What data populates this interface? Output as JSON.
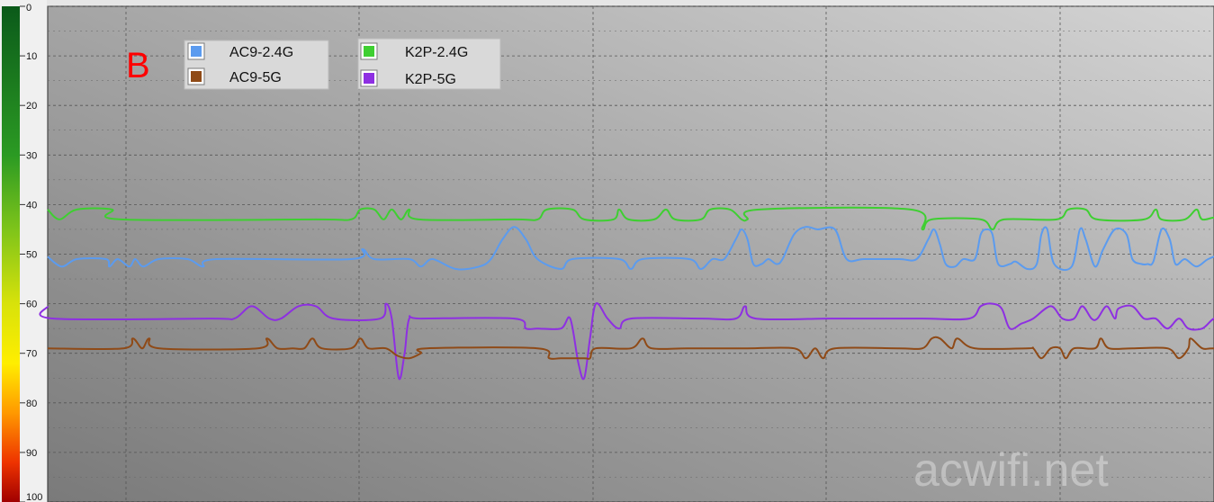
{
  "chart_data": {
    "type": "line",
    "panel_letter": "B",
    "watermark": "acwifi.net",
    "y_scale": "color_bar",
    "ylim": [
      0,
      100
    ],
    "y_inverted": true,
    "y_ticks": [
      0,
      10,
      20,
      30,
      40,
      50,
      60,
      70,
      80,
      90,
      100
    ],
    "x_range": [
      0,
      100
    ],
    "grid": true,
    "legend_placement": "top-left",
    "series": [
      {
        "name": "AC9-2.4G",
        "color": "#5b9bef",
        "points": [
          [
            0,
            50.5
          ],
          [
            1.2,
            52.5
          ],
          [
            2.5,
            51
          ],
          [
            5,
            51
          ],
          [
            5.3,
            52.5
          ],
          [
            6,
            51
          ],
          [
            7,
            52.5
          ],
          [
            7.5,
            51
          ],
          [
            8.2,
            52.5
          ],
          [
            9.5,
            51
          ],
          [
            12,
            51
          ],
          [
            13.3,
            52.5
          ],
          [
            14.5,
            51
          ],
          [
            26,
            51
          ],
          [
            27,
            49
          ],
          [
            28,
            51
          ],
          [
            31,
            51
          ],
          [
            32,
            52.5
          ],
          [
            33,
            51
          ],
          [
            35,
            53
          ],
          [
            37,
            52.5
          ],
          [
            38,
            51
          ],
          [
            39,
            47
          ],
          [
            40,
            44.5
          ],
          [
            41,
            47
          ],
          [
            42,
            51
          ],
          [
            44,
            53
          ],
          [
            45,
            51
          ],
          [
            49,
            51
          ],
          [
            50,
            53
          ],
          [
            51,
            51
          ],
          [
            55,
            51
          ],
          [
            56,
            53
          ],
          [
            57,
            51
          ],
          [
            58,
            51
          ],
          [
            59,
            47
          ],
          [
            59.5,
            45
          ],
          [
            60,
            47
          ],
          [
            60.5,
            52
          ],
          [
            61.2,
            52
          ],
          [
            61.8,
            51
          ],
          [
            62.5,
            52
          ],
          [
            63,
            51
          ],
          [
            64,
            46
          ],
          [
            65,
            44.5
          ],
          [
            66,
            45
          ],
          [
            67.5,
            45
          ],
          [
            68.5,
            51
          ],
          [
            70,
            51
          ],
          [
            73,
            51
          ],
          [
            74.5,
            51
          ],
          [
            75.5,
            47
          ],
          [
            76,
            45
          ],
          [
            76.5,
            48
          ],
          [
            77,
            52
          ],
          [
            77.8,
            52.5
          ],
          [
            78.5,
            51
          ],
          [
            79.5,
            51
          ],
          [
            80,
            46
          ],
          [
            80.5,
            45
          ],
          [
            81,
            46
          ],
          [
            81.5,
            52
          ],
          [
            82.5,
            52
          ],
          [
            83,
            51.5
          ],
          [
            84,
            53
          ],
          [
            84.8,
            52
          ],
          [
            85.2,
            46
          ],
          [
            85.7,
            45
          ],
          [
            86.3,
            52
          ],
          [
            87.8,
            52.5
          ],
          [
            88.5,
            45
          ],
          [
            89,
            47
          ],
          [
            89.8,
            52.5
          ],
          [
            90.5,
            49
          ],
          [
            91.5,
            45
          ],
          [
            92.5,
            46
          ],
          [
            93,
            51
          ],
          [
            93.8,
            52
          ],
          [
            94.3,
            52
          ],
          [
            94.8,
            51.5
          ],
          [
            95.5,
            45
          ],
          [
            96.2,
            47
          ],
          [
            96.7,
            52
          ],
          [
            97.5,
            51
          ],
          [
            98.5,
            52.5
          ],
          [
            99.5,
            51
          ],
          [
            100.5,
            50.5
          ],
          [
            101.5,
            53
          ],
          [
            102,
            54.5
          ],
          [
            103,
            52.5
          ],
          [
            104,
            52.5
          ]
        ]
      },
      {
        "name": "AC9-5G",
        "color": "#8f4a17",
        "points": [
          [
            0,
            69
          ],
          [
            6.5,
            69
          ],
          [
            7.3,
            67
          ],
          [
            8.1,
            69
          ],
          [
            8.7,
            67
          ],
          [
            9.6,
            69
          ],
          [
            18,
            69
          ],
          [
            18.8,
            67
          ],
          [
            19.7,
            69
          ],
          [
            21,
            69
          ],
          [
            22,
            69
          ],
          [
            22.7,
            67
          ],
          [
            23.5,
            69
          ],
          [
            26,
            69
          ],
          [
            26.8,
            67
          ],
          [
            27.5,
            69
          ],
          [
            29,
            69
          ],
          [
            30,
            70.5
          ],
          [
            31,
            71
          ],
          [
            32,
            70
          ],
          [
            32.5,
            69
          ],
          [
            42,
            69
          ],
          [
            43,
            71
          ],
          [
            44,
            71
          ],
          [
            46,
            71
          ],
          [
            46.5,
            71
          ],
          [
            47,
            69
          ],
          [
            50,
            69
          ],
          [
            51,
            67
          ],
          [
            51.8,
            69
          ],
          [
            55,
            69
          ],
          [
            60,
            69
          ],
          [
            64,
            69
          ],
          [
            65,
            71
          ],
          [
            65.8,
            69
          ],
          [
            66.5,
            71
          ],
          [
            67.5,
            69
          ],
          [
            73,
            69
          ],
          [
            75,
            69
          ],
          [
            75.8,
            67
          ],
          [
            76.5,
            67
          ],
          [
            77.5,
            69
          ],
          [
            78,
            67
          ],
          [
            79.5,
            69
          ],
          [
            84,
            69
          ],
          [
            84.5,
            69
          ],
          [
            85.2,
            71
          ],
          [
            86,
            69
          ],
          [
            86.8,
            69
          ],
          [
            87.3,
            71
          ],
          [
            88,
            69
          ],
          [
            89.8,
            69
          ],
          [
            90.3,
            67
          ],
          [
            91,
            69
          ],
          [
            93,
            69
          ],
          [
            96,
            69
          ],
          [
            97,
            71
          ],
          [
            97.8,
            69
          ],
          [
            98,
            67
          ],
          [
            99,
            69
          ],
          [
            100,
            69
          ],
          [
            104,
            69
          ]
        ]
      },
      {
        "name": "K2P-2.4G",
        "color": "#3ecf31",
        "points": [
          [
            0,
            41
          ],
          [
            1,
            43
          ],
          [
            2.5,
            41
          ],
          [
            5.5,
            41
          ],
          [
            6.3,
            43
          ],
          [
            23,
            43
          ],
          [
            26,
            43
          ],
          [
            26.8,
            41
          ],
          [
            28,
            41
          ],
          [
            28.8,
            43
          ],
          [
            29.5,
            41
          ],
          [
            30.3,
            43
          ],
          [
            31,
            41
          ],
          [
            31.8,
            43
          ],
          [
            40,
            43
          ],
          [
            42,
            43
          ],
          [
            42.8,
            41
          ],
          [
            45,
            41
          ],
          [
            46,
            43
          ],
          [
            48.5,
            43
          ],
          [
            49,
            41
          ],
          [
            49.8,
            43
          ],
          [
            52,
            43
          ],
          [
            53,
            41
          ],
          [
            53.8,
            43
          ],
          [
            56,
            43
          ],
          [
            56.8,
            41
          ],
          [
            58.5,
            41
          ],
          [
            59.5,
            43
          ],
          [
            60,
            43
          ],
          [
            61,
            41
          ],
          [
            74,
            41
          ],
          [
            75,
            45
          ],
          [
            75.8,
            43
          ],
          [
            80,
            43
          ],
          [
            81,
            45
          ],
          [
            82,
            43
          ],
          [
            86.5,
            43
          ],
          [
            87.5,
            41
          ],
          [
            89,
            41
          ],
          [
            90,
            43
          ],
          [
            94,
            43
          ],
          [
            95,
            41
          ],
          [
            95.5,
            43
          ],
          [
            97.5,
            43
          ],
          [
            98.5,
            41
          ],
          [
            99,
            43
          ],
          [
            100.5,
            43
          ],
          [
            101.5,
            49
          ],
          [
            102,
            47
          ],
          [
            103,
            45
          ],
          [
            104,
            45
          ]
        ]
      },
      {
        "name": "K2P-5G",
        "color": "#8e2fe2",
        "points": [
          [
            0,
            60.5
          ],
          [
            0.5,
            63
          ],
          [
            14,
            63
          ],
          [
            16,
            63
          ],
          [
            17.5,
            60.5
          ],
          [
            19,
            63
          ],
          [
            20,
            63
          ],
          [
            21.5,
            60.5
          ],
          [
            23,
            60.5
          ],
          [
            24.5,
            63
          ],
          [
            28.5,
            63
          ],
          [
            29,
            60
          ],
          [
            29.5,
            63
          ],
          [
            30.1,
            75
          ],
          [
            30.6,
            70
          ],
          [
            31,
            63
          ],
          [
            32,
            63
          ],
          [
            40,
            63
          ],
          [
            41,
            65
          ],
          [
            42,
            65
          ],
          [
            44,
            65
          ],
          [
            44.8,
            63
          ],
          [
            45.5,
            72
          ],
          [
            46,
            75
          ],
          [
            46.5,
            67
          ],
          [
            47,
            60
          ],
          [
            48,
            63
          ],
          [
            49,
            65
          ],
          [
            50,
            63
          ],
          [
            56,
            63
          ],
          [
            59,
            63
          ],
          [
            59.8,
            60.5
          ],
          [
            60.7,
            63
          ],
          [
            67,
            63
          ],
          [
            70,
            63
          ],
          [
            75,
            63
          ],
          [
            79,
            63
          ],
          [
            80,
            60.5
          ],
          [
            81,
            60
          ],
          [
            81.8,
            61
          ],
          [
            82.5,
            65
          ],
          [
            83.5,
            64
          ],
          [
            84.5,
            63
          ],
          [
            86,
            60.5
          ],
          [
            87,
            63
          ],
          [
            88,
            63
          ],
          [
            88.7,
            60.5
          ],
          [
            89.5,
            63
          ],
          [
            90,
            63
          ],
          [
            90.8,
            60.5
          ],
          [
            91.5,
            63
          ],
          [
            91.8,
            61
          ],
          [
            93,
            60.5
          ],
          [
            94,
            63
          ],
          [
            95,
            63
          ],
          [
            96,
            65
          ],
          [
            97,
            63
          ],
          [
            97.8,
            65
          ],
          [
            99,
            65
          ],
          [
            100,
            63
          ],
          [
            101,
            63
          ],
          [
            104,
            63
          ]
        ]
      }
    ]
  }
}
